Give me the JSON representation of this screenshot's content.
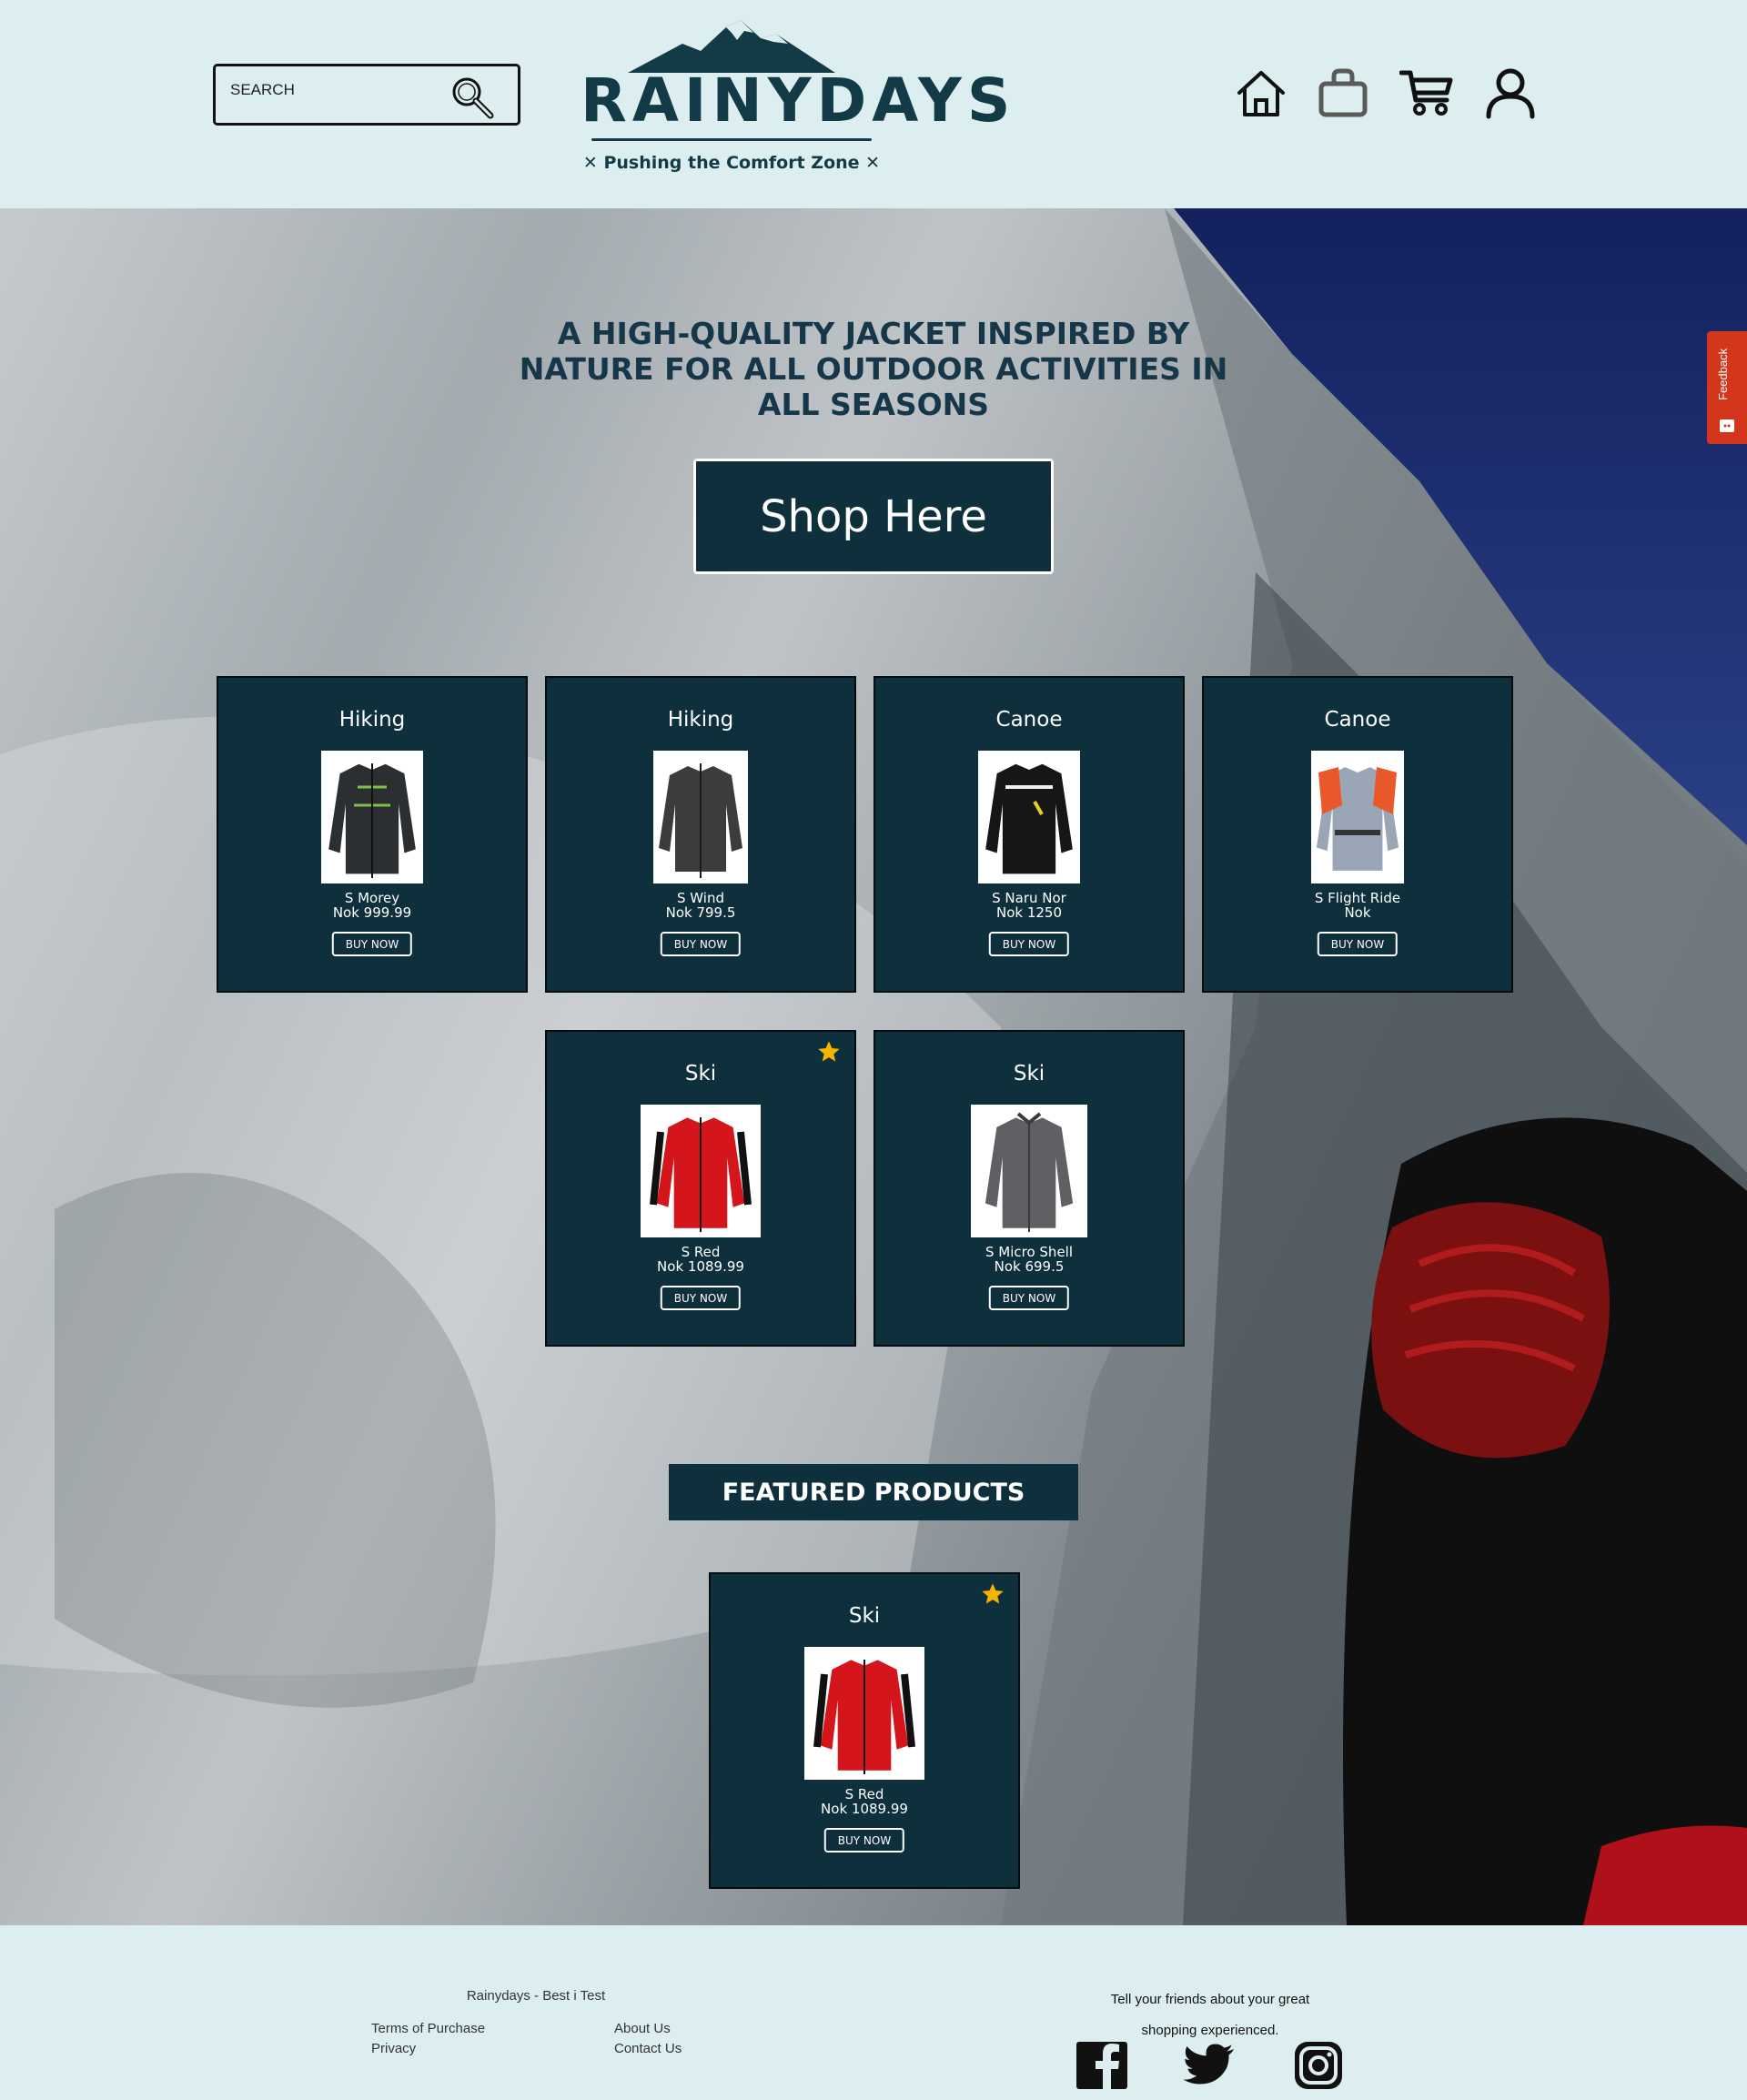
{
  "search": {
    "placeholder": "SEARCH"
  },
  "brand": {
    "name": "RAINYDAYS",
    "tagline": "✕ Pushing the Comfort Zone ✕"
  },
  "hero": {
    "heading": "A HIGH-QUALITY JACKET INSPIRED BY NATURE FOR ALL OUTDOOR ACTIVITIES IN ALL SEASONS",
    "cta_label": "Shop Here"
  },
  "products": [
    {
      "category": "Hiking",
      "name": "S Morey",
      "price": "Nok 999.99",
      "buy_label": "BUY NOW",
      "featured": false,
      "image": "black-hiking-jacket"
    },
    {
      "category": "Hiking",
      "name": "S Wind",
      "price": "Nok 799.5",
      "buy_label": "BUY NOW",
      "featured": false,
      "image": "dark-wind-jacket"
    },
    {
      "category": "Canoe",
      "name": "S Naru Nor",
      "price": "Nok 1250",
      "buy_label": "BUY NOW",
      "featured": false,
      "image": "black-yellow-canoe-jacket"
    },
    {
      "category": "Canoe",
      "name": "S Flight Ride",
      "price": "Nok",
      "buy_label": "BUY NOW",
      "featured": false,
      "image": "orange-grey-canoe-jacket"
    },
    {
      "category": "Ski",
      "name": "S Red",
      "price": "Nok 1089.99",
      "buy_label": "BUY NOW",
      "featured": true,
      "image": "red-ski-jacket"
    },
    {
      "category": "Ski",
      "name": "S Micro Shell",
      "price": "Nok 699.5",
      "buy_label": "BUY NOW",
      "featured": false,
      "image": "grey-ski-jacket"
    }
  ],
  "featured": {
    "heading": "FEATURED PRODUCTS",
    "product": {
      "category": "Ski",
      "name": "S Red",
      "price": "Nok 1089.99",
      "buy_label": "BUY NOW",
      "featured": true,
      "image": "red-ski-jacket"
    }
  },
  "feedback": {
    "label": "Feedback"
  },
  "footer": {
    "copyright": "Rainydays - Best i Test",
    "links": {
      "terms": "Terms of Purchase",
      "privacy": "Privacy",
      "about": "About Us",
      "contact": "Contact Us"
    },
    "share_line1": "Tell your friends about your great",
    "share_line2": "shopping experienced."
  },
  "icons": {
    "nav": [
      "home-icon",
      "shopping-bag-icon",
      "cart-icon",
      "user-icon"
    ],
    "social": [
      "facebook-icon",
      "twitter-icon",
      "instagram-icon"
    ],
    "favorite": "star-icon"
  },
  "colors": {
    "header_bg": "#dceef0",
    "brand_navy": "#123a47",
    "card_bg": "#0e2f3c",
    "star": "#f5b400",
    "feedback": "#d2371c"
  }
}
